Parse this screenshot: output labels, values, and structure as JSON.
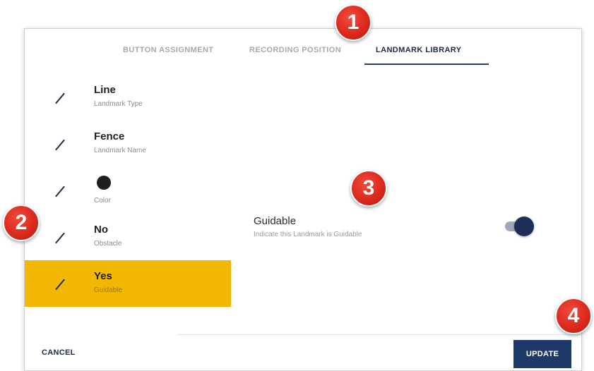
{
  "tabs": [
    {
      "label": "BUTTON ASSIGNMENT",
      "active": false
    },
    {
      "label": "RECORDING POSITION",
      "active": false
    },
    {
      "label": "LANDMARK LIBRARY",
      "active": true
    }
  ],
  "items": [
    {
      "title": "Line",
      "subtitle": "Landmark Type"
    },
    {
      "title": "Fence",
      "subtitle": "Landmark Name"
    },
    {
      "title": "",
      "subtitle": "Color",
      "swatch": "#1f1f1f"
    },
    {
      "title": "No",
      "subtitle": "Obstacle"
    },
    {
      "title": "Yes",
      "subtitle": "Guidable",
      "selected": true
    }
  ],
  "detail": {
    "title": "Guidable",
    "subtitle": "Indicate this Landmark is Guidable",
    "toggle_on": true
  },
  "footer": {
    "cancel_label": "CANCEL",
    "update_label": "UPDATE"
  },
  "callouts": [
    "1",
    "2",
    "3",
    "4"
  ],
  "colors": {
    "accent": "#1e3a69",
    "selected_row": "#f2b705",
    "callout": "#d8281b"
  }
}
